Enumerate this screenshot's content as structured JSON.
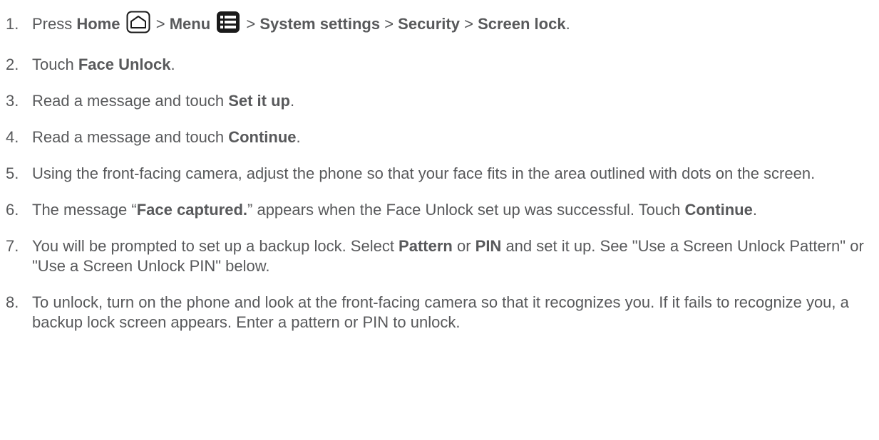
{
  "steps": [
    {
      "number": "1.",
      "parts": {
        "press": "Press ",
        "home": "Home",
        "sep1": " > ",
        "menu": "Menu",
        "sep2": " > ",
        "system_settings": "System settings",
        "sep3": " > ",
        "security": "Security",
        "sep4": " > ",
        "screen_lock": "Screen lock",
        "end": "."
      },
      "icons": [
        "home-icon",
        "menu-icon"
      ]
    },
    {
      "number": "2.",
      "parts": {
        "pre": "Touch ",
        "bold": "Face Unlock",
        "end": "."
      }
    },
    {
      "number": "3.",
      "parts": {
        "pre": "Read a message and touch ",
        "bold": "Set it up",
        "end": "."
      }
    },
    {
      "number": "4.",
      "parts": {
        "pre": "Read a message and touch ",
        "bold": "Continue",
        "end": "."
      }
    },
    {
      "number": "5.",
      "text": "Using the front-facing camera, adjust the phone so that your face fits in the area outlined with dots on the screen."
    },
    {
      "number": "6.",
      "parts": {
        "pre": "The message “",
        "bold1": "Face captured.",
        "mid": "” appears when the Face Unlock set up was successful. Touch ",
        "bold2": "Continue",
        "end": "."
      }
    },
    {
      "number": "7.",
      "parts": {
        "pre": "You will be prompted to set up a backup lock. Select ",
        "bold1": "Pattern",
        "mid": " or ",
        "bold2": "PIN",
        "post": " and set it up. See \"Use a Screen Unlock Pattern\" or \"Use a Screen Unlock PIN\" below."
      }
    },
    {
      "number": "8.",
      "text": "To unlock, turn on the phone and look at the front-facing camera so that it recognizes you. If it fails to recognize you, a backup lock screen appears. Enter a pattern or PIN to unlock."
    }
  ],
  "colors": {
    "text": "#58595b",
    "icon_stroke": "#1a1a1a"
  }
}
